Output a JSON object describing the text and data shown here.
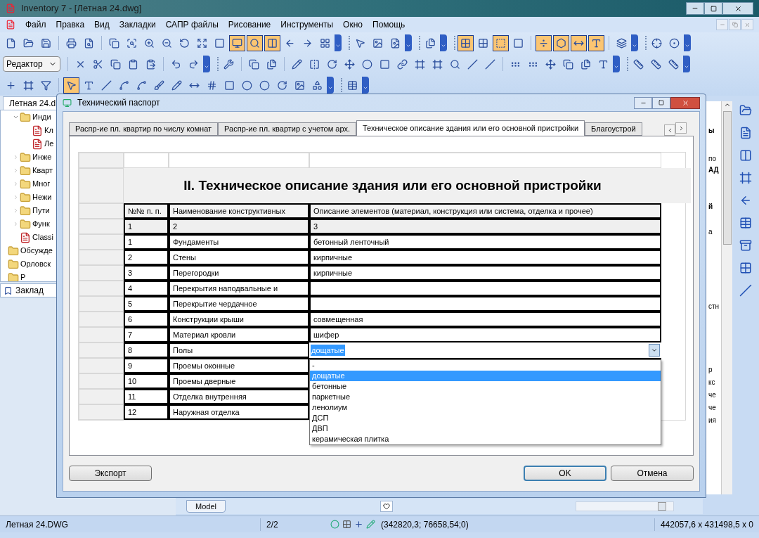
{
  "window": {
    "title": "Inventory 7 - [Летная 24.dwg]"
  },
  "menu": [
    "Файл",
    "Правка",
    "Вид",
    "Закладки",
    "САПР файлы",
    "Рисование",
    "Инструменты",
    "Окно",
    "Помощь"
  ],
  "toolbars": [
    {
      "buttons": [
        {
          "on": false
        },
        {
          "on": false
        },
        {
          "on": false
        },
        {
          "on": false
        },
        {
          "on": false
        },
        {
          "on": false
        },
        {
          "on": false
        },
        {
          "on": false
        },
        {
          "on": false
        },
        {
          "on": false
        },
        {
          "on": false
        },
        {
          "on": false
        },
        {
          "on": true
        },
        {
          "on": true
        },
        {
          "on": true
        },
        {
          "on": false
        },
        {
          "on": false
        },
        {
          "on": false
        },
        {
          "on": false
        },
        {
          "on": false
        },
        {
          "on": false
        },
        {
          "on": false
        },
        {
          "on": true
        },
        {
          "on": false
        },
        {
          "on": true
        },
        {
          "on": false
        },
        {
          "on": true
        },
        {
          "on": true
        },
        {
          "on": true
        },
        {
          "on": true
        },
        {
          "on": false
        },
        {
          "on": false
        },
        {
          "on": false
        }
      ]
    },
    {
      "buttons": [
        {
          "on": false
        },
        {
          "on": false
        },
        {
          "on": false
        },
        {
          "on": false
        },
        {
          "on": false
        },
        {
          "on": false
        },
        {
          "on": false
        },
        {
          "on": false
        },
        {
          "on": false
        },
        {
          "on": false
        },
        {
          "on": false
        },
        {
          "on": false
        },
        {
          "on": false
        },
        {
          "on": false
        },
        {
          "on": false
        },
        {
          "on": false
        },
        {
          "on": false
        },
        {
          "on": false
        },
        {
          "on": false
        },
        {
          "on": false
        },
        {
          "on": false
        },
        {
          "on": false
        },
        {
          "on": false
        },
        {
          "on": false
        },
        {
          "on": false
        },
        {
          "on": false
        },
        {
          "on": false
        },
        {
          "on": false
        },
        {
          "on": false
        },
        {
          "on": false
        },
        {
          "on": false
        }
      ]
    },
    {
      "buttons": [
        {
          "on": false
        },
        {
          "on": false
        },
        {
          "on": false
        },
        {
          "on": true
        },
        {
          "on": false
        },
        {
          "on": false
        },
        {
          "on": false
        },
        {
          "on": false
        },
        {
          "on": false
        },
        {
          "on": false
        },
        {
          "on": false
        },
        {
          "on": false
        },
        {
          "on": false
        },
        {
          "on": false
        },
        {
          "on": false
        },
        {
          "on": false
        },
        {
          "on": false
        },
        {
          "on": false
        },
        {
          "on": false
        }
      ]
    }
  ],
  "mode_select": {
    "value": "Редактор"
  },
  "left_panel": {
    "tab": "Летная 24.d",
    "tree": [
      {
        "children": [
          {
            "label": "Инди",
            "kind": "folder",
            "expanded": true,
            "children": [
              {
                "label": "Кл",
                "kind": "doc"
              },
              {
                "label": "Ле",
                "kind": "doc"
              }
            ]
          },
          {
            "label": "Инже",
            "kind": "folder",
            "expanded": false
          },
          {
            "label": "Кварт",
            "kind": "folder",
            "expanded": false
          },
          {
            "label": "Мног",
            "kind": "folder",
            "expanded": false
          },
          {
            "label": "Нежи",
            "kind": "folder",
            "expanded": false
          },
          {
            "label": "Пути",
            "kind": "folder",
            "expanded": false
          },
          {
            "label": "Функ",
            "kind": "folder",
            "expanded": false
          },
          {
            "label": "Classi",
            "kind": "doc"
          }
        ]
      },
      {
        "label": "Обсужде",
        "kind": "folder"
      },
      {
        "label": "Орловск",
        "kind": "folder"
      },
      {
        "label": "Р",
        "kind": "folder"
      }
    ],
    "bookmarks_tab": "Заклад"
  },
  "right_panel": {
    "fragments": [
      {
        "text": "ы",
        "bold": true
      },
      {
        "text": "по",
        "bold": false
      },
      {
        "text": "АД",
        "bold": true
      },
      {
        "text": "й",
        "bold": true
      },
      {
        "text": "а",
        "bold": false
      },
      {
        "text": "стн",
        "bold": false
      },
      {
        "text": "р",
        "bold": false
      },
      {
        "text": "кс",
        "bold": false
      },
      {
        "text": "че",
        "bold": false
      },
      {
        "text": "че",
        "bold": false
      },
      {
        "text": "ия",
        "bold": false
      }
    ]
  },
  "drawing_area": {
    "layout_tab": "Model"
  },
  "dialog": {
    "title": "Технический паспорт",
    "tabs": [
      {
        "label": "Распр-ие пл. квартир по числу комнат",
        "selected": false
      },
      {
        "label": "Распр-ие пл. квартир с учетом арх.",
        "selected": false
      },
      {
        "label": "Техническое описание здания или его основной пристройки",
        "selected": true
      },
      {
        "label": "Благоустрой",
        "selected": false
      }
    ],
    "table": {
      "title": "II. Техническое описание здания или его основной пристройки",
      "columns": [
        "№№ п. п.",
        "Наименование конструктивных",
        "Описание элементов (материал, конструкция или система, отделка и прочее)"
      ],
      "index_row": [
        "1",
        "2",
        "3"
      ],
      "rows": [
        {
          "num": "1",
          "name": "Фундаменты",
          "desc": "бетонный ленточный"
        },
        {
          "num": "2",
          "name": "Стены",
          "desc": "кирпичные"
        },
        {
          "num": "3",
          "name": "Перегородки",
          "desc": "кирпичные"
        },
        {
          "num": "4",
          "name": "Перекрытия наподвальные и"
        },
        {
          "num": "5",
          "name": "Перекрытие чердачное"
        },
        {
          "num": "6",
          "name": "Конструкции крыши",
          "desc": "совмещенная"
        },
        {
          "num": "7",
          "name": "Материал кровли",
          "desc": "шифер"
        },
        {
          "num": "8",
          "name": "Полы",
          "editor": {
            "value": "дощатые",
            "options": [
              {
                "label": "-",
                "selected": false
              },
              {
                "label": "дощатые",
                "selected": true
              },
              {
                "label": "бетонные",
                "selected": false
              },
              {
                "label": "паркетные",
                "selected": false
              },
              {
                "label": "ленолиум",
                "selected": false
              },
              {
                "label": "ДСП",
                "selected": false
              },
              {
                "label": "ДВП",
                "selected": false
              },
              {
                "label": "керамическая плитка",
                "selected": false
              }
            ]
          }
        },
        {
          "num": "9",
          "name": "Проемы оконные"
        },
        {
          "num": "10",
          "name": "Проемы дверные"
        },
        {
          "num": "11",
          "name": "Отделка внутренняя"
        },
        {
          "num": "12",
          "name": "Наружная отделка"
        }
      ]
    },
    "buttons": [
      {
        "label": "Экспорт",
        "kind": "normal"
      },
      {
        "label": "OK",
        "kind": "default"
      },
      {
        "label": "Отмена",
        "kind": "normal"
      }
    ]
  },
  "status_bar": {
    "file": "Летная 24.DWG",
    "page": "2/2",
    "coords": "(342820,3; 76658,54;0)",
    "size": "442057,6 x 431498,5 x 0"
  }
}
